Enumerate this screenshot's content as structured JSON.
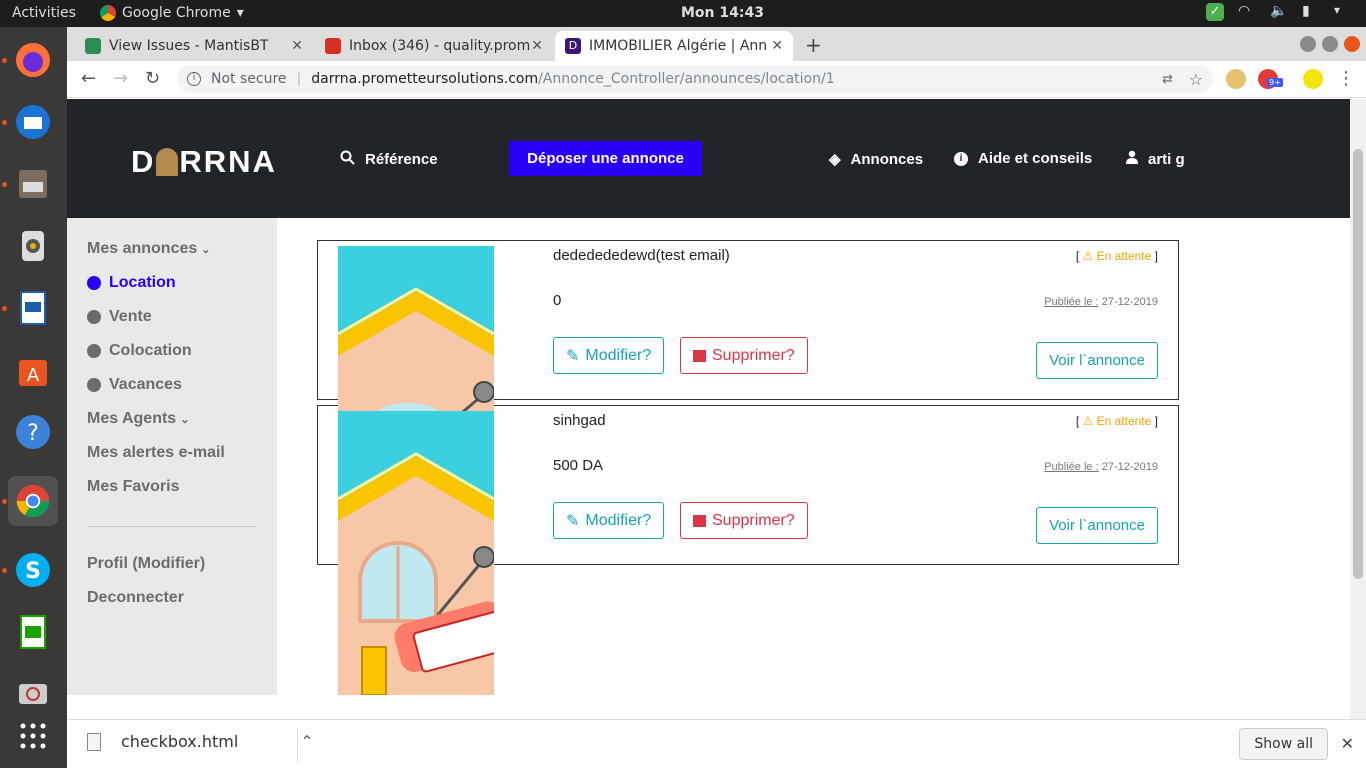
{
  "topbar": {
    "activities": "Activities",
    "app_name": "Google Chrome",
    "clock": "Mon 14:43"
  },
  "browser": {
    "tabs": [
      {
        "title": "View Issues - MantisBT",
        "favicon_color": "#2e8b57"
      },
      {
        "title": "Inbox (346) - quality.prom",
        "favicon_color": "#d93025"
      },
      {
        "title": "IMMOBILIER Algérie | Ann",
        "favicon_color": "#3a1778"
      }
    ],
    "new_tab": "+",
    "address": {
      "not_secure": "Not secure",
      "host": "darrna.prometteursolutions.com",
      "path": "/Annonce_Controller/announces/location/1"
    },
    "extension_badge": "9+"
  },
  "site": {
    "logo": {
      "left": "D",
      "right": "RRNA"
    },
    "nav": {
      "reference": "Référence",
      "deposer": "Déposer une annonce",
      "annonces": "Annonces",
      "aide": "Aide et conseils",
      "user": "arti g"
    },
    "sidebar": {
      "mes_annonces": "Mes annonces",
      "location": "Location",
      "vente": "Vente",
      "colocation": "Colocation",
      "vacances": "Vacances",
      "mes_agents": "Mes Agents",
      "alertes": "Mes alertes e-mail",
      "favoris": "Mes Favoris",
      "profil": "Profil (Modifier)",
      "deconnecter": "Deconnecter"
    },
    "listings": [
      {
        "title": "dededededewd(test email)",
        "price": "0",
        "status": "En attente",
        "published_label": "Publiée le :",
        "published_date": "27-12-2019",
        "modifier": "Modifier?",
        "supprimer": "Supprimer?",
        "voir": "Voir l`annonce"
      },
      {
        "title": "sinhgad",
        "price": "500 DA",
        "status": "En attente",
        "published_label": "Publiée le :",
        "published_date": "27-12-2019",
        "modifier": "Modifier?",
        "supprimer": "Supprimer?",
        "voir": "Voir l`annonce"
      }
    ]
  },
  "downloads": {
    "file": "checkbox.html",
    "show_all": "Show all"
  }
}
